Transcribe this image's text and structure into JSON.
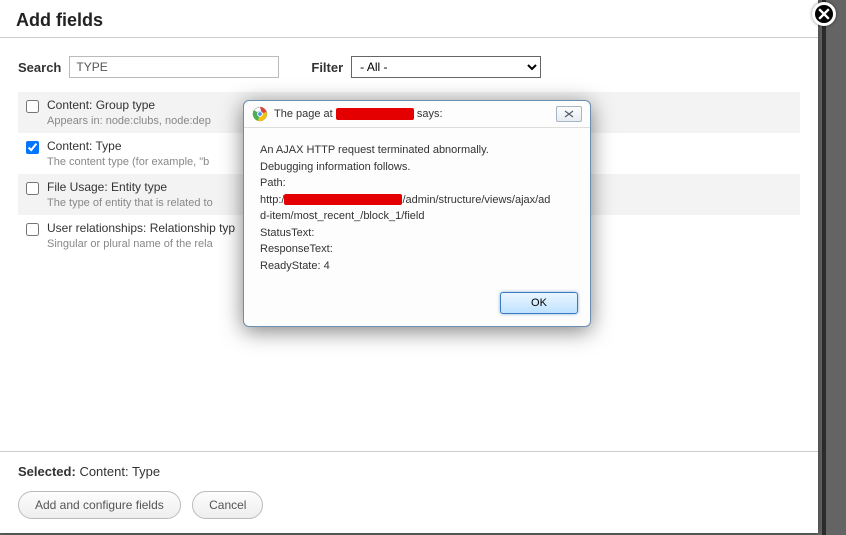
{
  "header": {
    "title": "Add fields"
  },
  "search": {
    "label": "Search",
    "value": "TYPE"
  },
  "filter": {
    "label": "Filter",
    "selected": "- All -"
  },
  "fields": [
    {
      "name": "Content: Group type",
      "desc": "Appears in: node:clubs, node:dep",
      "checked": false
    },
    {
      "name": "Content: Type",
      "desc": "The content type (for example, \"b",
      "checked": true
    },
    {
      "name": "File Usage: Entity type",
      "desc": "The type of entity that is related to",
      "checked": false
    },
    {
      "name": "User relationships: Relationship typ",
      "desc": "Singular or plural name of the rela",
      "checked": false
    }
  ],
  "selected": {
    "label": "Selected:",
    "value": "Content: Type"
  },
  "buttons": {
    "primary": "Add and configure fields",
    "cancel": "Cancel"
  },
  "alert": {
    "title_prefix": "The page at",
    "title_suffix": "says:",
    "lines": {
      "l1": "An AJAX HTTP request terminated abnormally.",
      "l2": "Debugging information follows.",
      "l3": "Path:",
      "l4a": "http:/",
      "l4b": "/admin/structure/views/ajax/ad",
      "l5": "d-item/most_recent_/block_1/field",
      "l6": "StatusText:",
      "l7": "ResponseText:",
      "l8": "ReadyState: 4"
    },
    "ok": "OK"
  }
}
